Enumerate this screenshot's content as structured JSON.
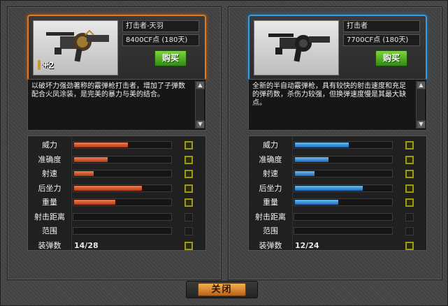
{
  "panels": {
    "left": {
      "name": "打击者-天羽",
      "price": "8400CF点 (180天)",
      "buy_label": "购买",
      "bonus": "+2",
      "description": "以破坏力强劲著称的霰弹枪打击者，增加了子弹数配合火凤涂装，是完美的暴力与美的结合。",
      "stats": [
        {
          "label": "威力",
          "value": 0.55,
          "compare": true
        },
        {
          "label": "准确度",
          "value": 0.34,
          "compare": true
        },
        {
          "label": "射速",
          "value": 0.2,
          "compare": true
        },
        {
          "label": "后坐力",
          "value": 0.69,
          "compare": true
        },
        {
          "label": "重量",
          "value": 0.42,
          "compare": true
        },
        {
          "label": "射击距离",
          "value": 0,
          "compare": false
        },
        {
          "label": "范围",
          "value": 0,
          "compare": false
        }
      ],
      "ammo_label": "装弹数",
      "ammo": "14/28"
    },
    "right": {
      "name": "打击者",
      "price": "7700CF点 (180天)",
      "buy_label": "购买",
      "description": "全新的半自动霰弹枪，具有较快的射击速度和充足的弹药数，杀伤力较强，但换弹速度慢是其最大缺点。",
      "stats": [
        {
          "label": "威力",
          "value": 0.55,
          "compare": true
        },
        {
          "label": "准确度",
          "value": 0.34,
          "compare": true
        },
        {
          "label": "射速",
          "value": 0.2,
          "compare": true
        },
        {
          "label": "后坐力",
          "value": 0.69,
          "compare": true
        },
        {
          "label": "重量",
          "value": 0.44,
          "compare": true
        },
        {
          "label": "射击距离",
          "value": 0,
          "compare": false
        },
        {
          "label": "范围",
          "value": 0,
          "compare": false
        }
      ],
      "ammo_label": "装弹数",
      "ammo": "12/24"
    }
  },
  "close_label": "关闭",
  "colors": {
    "left_accent": "#e07a20",
    "right_accent": "#3a9be0",
    "left_bar": "#d85a30",
    "right_bar": "#3a9be0",
    "buy_button": "#4caf22",
    "close_button": "#e8963a"
  },
  "icons": [
    "shotgun-image",
    "ammo-icon",
    "scroll-up-icon",
    "scroll-down-icon",
    "compare-checkbox"
  ]
}
